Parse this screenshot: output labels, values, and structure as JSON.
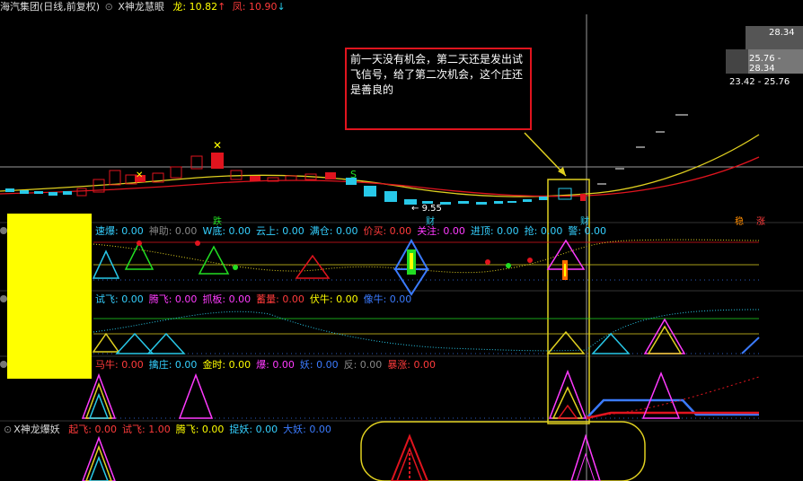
{
  "header": {
    "stock_name": "海汽集团(日线,前复权)",
    "indicator_name": "X神龙慧眼",
    "long_label": "龙:",
    "long_value": "10.82",
    "long_arrow": "↑",
    "phoenix_label": "凤:",
    "phoenix_value": "10.90",
    "phoenix_arrow": "↓"
  },
  "annotation": {
    "text": "前一天没有机会，第二天还是发出试飞信号，给了第二次机会，这个庄还是善良的"
  },
  "price_labels": {
    "top_right": "28.34",
    "mid_right": "25.76 - 28.34",
    "lower_right": "23.42 - 25.76",
    "low_marker": "9.55"
  },
  "marker_tags": {
    "die": "跌",
    "cai1": "财",
    "cai2": "财",
    "wen": "稳",
    "zhang": "涨"
  },
  "panel1": {
    "items": [
      {
        "label": "速爆:",
        "value": "0.00",
        "color": "#35d0ff"
      },
      {
        "label": "神助:",
        "value": "0.00",
        "color": "#888888"
      },
      {
        "label": "W底:",
        "value": "0.00",
        "color": "#35d0ff"
      },
      {
        "label": "云上:",
        "value": "0.00",
        "color": "#35d0ff"
      },
      {
        "label": "满仓:",
        "value": "0.00",
        "color": "#35d0ff"
      },
      {
        "label": "价买:",
        "value": "0.00",
        "color": "#ff3b3b"
      },
      {
        "label": "关注:",
        "value": "0.00",
        "color": "#ff3bff"
      },
      {
        "label": "进顶:",
        "value": "0.00",
        "color": "#35d0ff"
      },
      {
        "label": "抢:",
        "value": "0.00",
        "color": "#35d0ff"
      },
      {
        "label": "警:",
        "value": "0.00",
        "color": "#35d0ff"
      }
    ]
  },
  "panel2": {
    "items": [
      {
        "label": "试飞:",
        "value": "0.00",
        "color": "#35d0ff"
      },
      {
        "label": "腾飞:",
        "value": "0.00",
        "color": "#ff3bff"
      },
      {
        "label": "抓板:",
        "value": "0.00",
        "color": "#ff3bff"
      },
      {
        "label": "蓄量:",
        "value": "0.00",
        "color": "#ff3b3b"
      },
      {
        "label": "伏牛:",
        "value": "0.00",
        "color": "#ffff00"
      },
      {
        "label": "像牛:",
        "value": "0.00",
        "color": "#3b7bff"
      }
    ]
  },
  "panel3": {
    "items": [
      {
        "label": "马牛:",
        "value": "0.00",
        "color": "#ff3b3b"
      },
      {
        "label": "擒庄:",
        "value": "0.00",
        "color": "#35d0ff"
      },
      {
        "label": "金时:",
        "value": "0.00",
        "color": "#ffff00"
      },
      {
        "label": "爆:",
        "value": "0.00",
        "color": "#ff3bff"
      },
      {
        "label": "妖:",
        "value": "0.00",
        "color": "#3b7bff"
      },
      {
        "label": "反:",
        "value": "0.00",
        "color": "#888888"
      },
      {
        "label": "暴涨:",
        "value": "0.00",
        "color": "#ff3b3b"
      }
    ]
  },
  "panel4": {
    "name": "X神龙爆妖",
    "items": [
      {
        "label": "起飞:",
        "value": "0.00",
        "color": "#ff3b3b"
      },
      {
        "label": "试飞:",
        "value": "1.00",
        "color": "#ff3b3b"
      },
      {
        "label": "腾飞:",
        "value": "0.00",
        "color": "#ffff00"
      },
      {
        "label": "捉妖:",
        "value": "0.00",
        "color": "#35d0ff"
      },
      {
        "label": "大妖:",
        "value": "0.00",
        "color": "#3b7bff"
      }
    ]
  }
}
